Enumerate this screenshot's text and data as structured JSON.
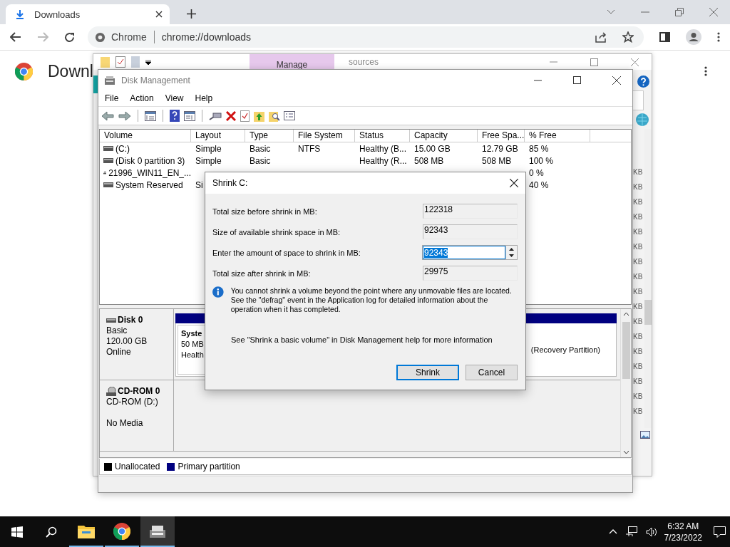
{
  "browser": {
    "tabs": [
      {
        "title": "Downloads",
        "selected": true
      }
    ],
    "address": {
      "site": "Chrome",
      "url": "chrome://downloads"
    },
    "page_title": "Downl"
  },
  "explorer": {
    "ribbon_tab": "Manage",
    "ribbon_text": "sources",
    "size_column": [
      "KB",
      "KB",
      "KB",
      "KB",
      "KB",
      "KB",
      "KB",
      "KB",
      "KB",
      "KB",
      "KB",
      "KB",
      "KB",
      "KB",
      "KB",
      "KB",
      "KB"
    ]
  },
  "disk_management": {
    "title": "Disk Management",
    "menu": [
      "File",
      "Action",
      "View",
      "Help"
    ],
    "columns": [
      "Volume",
      "Layout",
      "Type",
      "File System",
      "Status",
      "Capacity",
      "Free Spa...",
      "% Free"
    ],
    "rows": [
      {
        "kind": "disk",
        "cells": [
          "(C:)",
          "Simple",
          "Basic",
          "NTFS",
          "Healthy (B...",
          "15.00 GB",
          "12.79 GB",
          "85 %"
        ]
      },
      {
        "kind": "disk",
        "cells": [
          "(Disk 0 partition 3)",
          "Simple",
          "Basic",
          null,
          "Healthy (R...",
          "508 MB",
          "508 MB",
          "100 %"
        ]
      },
      {
        "kind": "cd",
        "cells": [
          "21996_WIN11_EN_...",
          null,
          null,
          null,
          null,
          null,
          null,
          "0 %"
        ]
      },
      {
        "kind": "disk",
        "cells": [
          "System Reserved",
          "Si",
          null,
          null,
          null,
          null,
          null,
          "40 %"
        ]
      }
    ],
    "disks": [
      {
        "kind": "disk",
        "name": "Disk 0",
        "type": "Basic",
        "size": "120.00 GB",
        "status": "Online",
        "partitions": [
          {
            "lines": [
              "Syste",
              "50 MB",
              "Health"
            ]
          },
          {
            "lines": [
              "(Recovery Partition)"
            ]
          }
        ]
      },
      {
        "kind": "cd",
        "name": "CD-ROM 0",
        "type": "CD-ROM (D:)",
        "status": "No Media"
      }
    ],
    "legend": [
      {
        "label": "Unallocated",
        "color": "#000000"
      },
      {
        "label": "Primary partition",
        "color": "#000080"
      }
    ]
  },
  "dialog": {
    "title": "Shrink C:",
    "fields": [
      {
        "kind": "readonly",
        "label": "Total size before shrink in MB:",
        "value": "122318"
      },
      {
        "kind": "readonly",
        "label": "Size of available shrink space in MB:",
        "value": "92343"
      },
      {
        "kind": "spin",
        "label": "Enter the amount of space to shrink in MB:",
        "value": "92343",
        "text_selected": true
      },
      {
        "kind": "readonly",
        "label": "Total size after shrink in MB:",
        "value": "29975"
      }
    ],
    "info": "You cannot shrink a volume beyond the point where any unmovable files are located. See the \"defrag\" event in the Application log for detailed information about the operation when it has completed.",
    "help": "See \"Shrink a basic volume\" in Disk Management help for more information",
    "buttons": [
      {
        "label": "Shrink",
        "default": true
      },
      {
        "label": "Cancel",
        "default": false
      }
    ]
  },
  "taskbar": {
    "apps": [
      {
        "kind": "folder",
        "active": false
      },
      {
        "kind": "browser",
        "active": false
      },
      {
        "kind": "disk",
        "active": true
      }
    ],
    "time": "6:32 AM",
    "date": "7/23/2022"
  }
}
